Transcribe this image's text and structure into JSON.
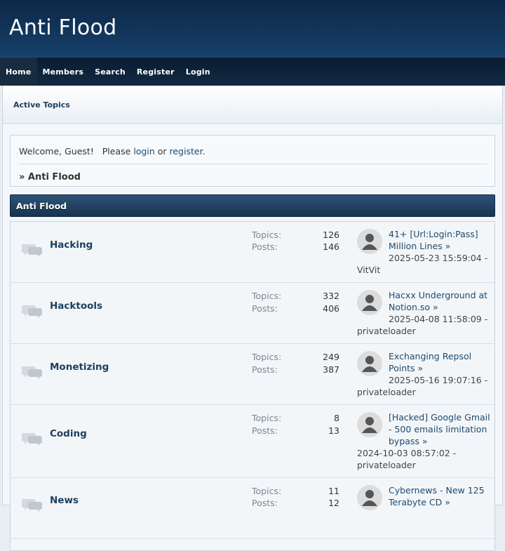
{
  "site": {
    "title": "Anti Flood"
  },
  "nav": {
    "items": [
      {
        "label": "Home",
        "active": true
      },
      {
        "label": "Members"
      },
      {
        "label": "Search"
      },
      {
        "label": "Register"
      },
      {
        "label": "Login"
      }
    ]
  },
  "active_topics": "Active Topics",
  "welcome": {
    "prefix": "Welcome, Guest!   Please ",
    "login": "login",
    "or": " or ",
    "register": "register",
    "suffix": "."
  },
  "breadcrumb": "» Anti Flood",
  "category": {
    "title": "Anti Flood"
  },
  "labels": {
    "topics": "Topics:",
    "posts": "Posts:"
  },
  "forums": [
    {
      "name": "Hacking",
      "topics": "126",
      "posts": "146",
      "last_title_1": "41+ [Url:Login:Pass]",
      "last_title_2": "Million Lines »",
      "last_date": "2025-05-23 15:59:04 -",
      "last_user": "VitVit"
    },
    {
      "name": "Hacktools",
      "topics": "332",
      "posts": "406",
      "last_title_1": "Hacxx Underground at",
      "last_title_2": "Notion.so »",
      "last_date": "2025-04-08 11:58:09 -",
      "last_user": "privateloader"
    },
    {
      "name": "Monetizing",
      "topics": "249",
      "posts": "387",
      "last_title_1": "Exchanging Repsol",
      "last_title_2": "Points »",
      "last_date": "2025-05-16 19:07:16 -",
      "last_user": "privateloader"
    },
    {
      "name": "Coding",
      "topics": "8",
      "posts": "13",
      "last_title_1": "[Hacked] Google Gmail",
      "last_title_2": "- 500 emails limitation",
      "last_title_3": "bypass »",
      "last_date": "2024-10-03 08:57:02 -",
      "last_user": "privateloader"
    },
    {
      "name": "News",
      "topics": "11",
      "posts": "12",
      "last_title_1": "Cybernews - New 125",
      "last_title_2": "Terabyte CD »",
      "last_date": "",
      "last_user": ""
    }
  ]
}
